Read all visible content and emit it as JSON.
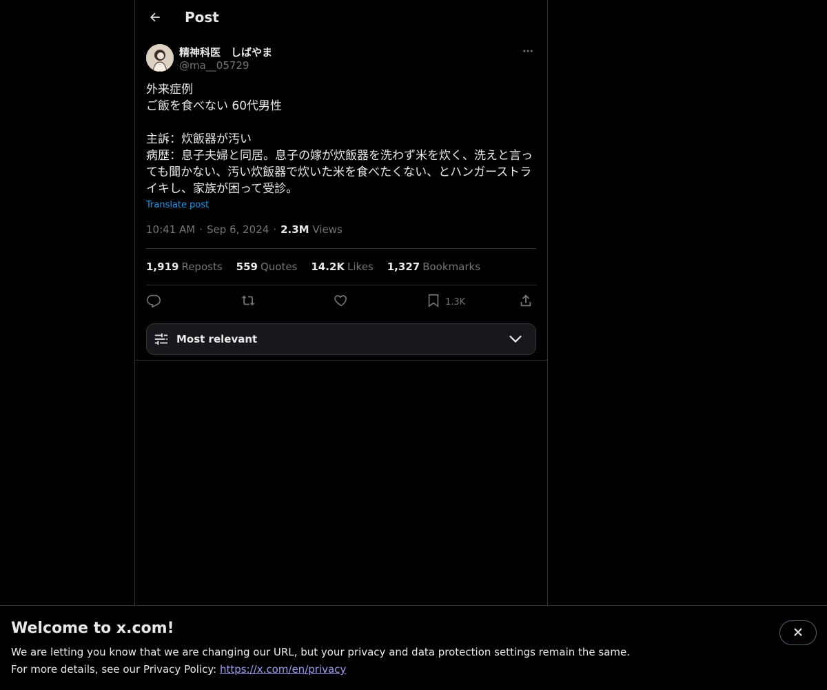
{
  "header": {
    "title": "Post"
  },
  "author": {
    "display_name": "精神科医　しばやま",
    "handle": "@ma__05729"
  },
  "post": {
    "text": "外来症例\nご飯を食べない 60代男性\n\n主訴：炊飯器が汚い\n病歴：息子夫婦と同居。息子の嫁が炊飯器を洗わず米を炊く、洗えと言っても聞かない、汚い炊飯器で炊いた米を食べたくない、とハンガーストライキし、家族が困って受診。",
    "translate_label": "Translate post",
    "time": "10:41 AM",
    "date": "Sep 6, 2024",
    "views_count": "2.3M",
    "views_label": "Views"
  },
  "stats": {
    "reposts_count": "1,919",
    "reposts_label": "Reposts",
    "quotes_count": "559",
    "quotes_label": "Quotes",
    "likes_count": "14.2K",
    "likes_label": "Likes",
    "bookmarks_count": "1,327",
    "bookmarks_label": "Bookmarks"
  },
  "actions": {
    "bookmark_count": "1.3K",
    "icons": [
      "reply-icon",
      "repost-icon",
      "like-icon",
      "bookmark-icon",
      "share-icon"
    ]
  },
  "sort": {
    "label": "Most relevant"
  },
  "banner": {
    "title": "Welcome to x.com!",
    "line1": "We are letting you know that we are changing our URL, but your privacy and data protection settings remain the same.",
    "line2_prefix": "For more details, see our Privacy Policy: ",
    "link": "https://x.com/en/privacy"
  },
  "colors": {
    "background": "#000000",
    "text": "#e7e9ea",
    "muted": "#71767b",
    "accent": "#1d9bf0",
    "border": "#2f3336"
  }
}
